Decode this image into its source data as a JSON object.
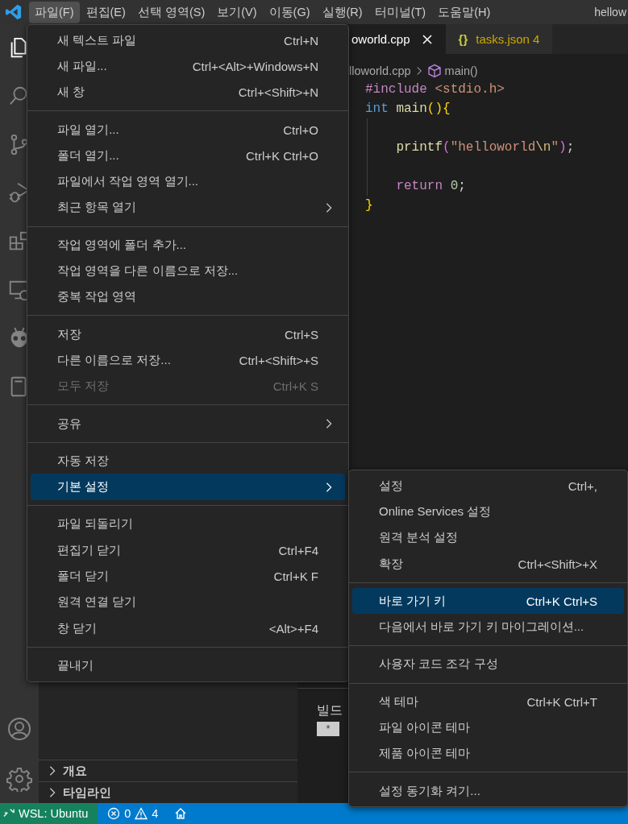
{
  "menubar": [
    {
      "label": "파일(F)",
      "selected": true
    },
    {
      "label": "편집(E)",
      "selected": false
    },
    {
      "label": "선택 영역(S)",
      "selected": false
    },
    {
      "label": "보기(V)",
      "selected": false
    },
    {
      "label": "이동(G)",
      "selected": false
    },
    {
      "label": "실행(R)",
      "selected": false
    },
    {
      "label": "터미널(T)",
      "selected": false
    },
    {
      "label": "도움말(H)",
      "selected": false
    }
  ],
  "window_title": "hellow",
  "activity_bar": [
    {
      "kind": "explorer",
      "selected": true
    },
    {
      "kind": "search",
      "selected": false
    },
    {
      "kind": "source-control",
      "selected": false
    },
    {
      "kind": "run-debug",
      "selected": false
    },
    {
      "kind": "extensions",
      "selected": false
    },
    {
      "kind": "remote",
      "selected": false
    },
    {
      "kind": "alien",
      "selected": false
    },
    {
      "kind": "notebook",
      "selected": false
    }
  ],
  "activity_bar_bottom": [
    {
      "kind": "account"
    },
    {
      "kind": "settings"
    }
  ],
  "sidebar_sections": [
    {
      "label": "개요",
      "expanded": false
    },
    {
      "label": "타임라인",
      "expanded": false
    }
  ],
  "tabs": [
    {
      "label": "oworld.cpp",
      "selected": true,
      "kind": "cpp"
    },
    {
      "label": "tasks.json 4",
      "icon": "{}",
      "selected": false,
      "kind": "json"
    }
  ],
  "breadcrumb": [
    {
      "label": "lloworld.cpp",
      "kind": "file"
    },
    {
      "label": "main()",
      "kind": "symbol"
    }
  ],
  "code_lines": [
    {
      "kind": "code",
      "tokens": [
        {
          "kind": "directive",
          "text": "#include "
        },
        {
          "kind": "include",
          "text": "<stdio.h>"
        }
      ]
    },
    {
      "kind": "code",
      "tokens": [
        {
          "kind": "keyword",
          "text": "int "
        },
        {
          "kind": "function",
          "text": "main"
        },
        {
          "kind": "bracket1",
          "text": "(){"
        }
      ]
    },
    {
      "kind": "blank"
    },
    {
      "kind": "nested",
      "tokens": [
        {
          "kind": "function",
          "text": "printf"
        },
        {
          "kind": "bracket2",
          "text": "("
        },
        {
          "kind": "string",
          "text": "\"helloworld"
        },
        {
          "kind": "escape",
          "text": "\\n"
        },
        {
          "kind": "string",
          "text": "\""
        },
        {
          "kind": "bracket2",
          "text": ")"
        },
        {
          "kind": "plain",
          "text": ";"
        }
      ]
    },
    {
      "kind": "blank"
    },
    {
      "kind": "nested",
      "tokens": [
        {
          "kind": "control",
          "text": "return "
        },
        {
          "kind": "number",
          "text": "0"
        },
        {
          "kind": "plain",
          "text": ";"
        }
      ]
    },
    {
      "kind": "code",
      "tokens": [
        {
          "kind": "bracket1",
          "text": "}"
        }
      ]
    }
  ],
  "terminal": {
    "lines": [
      "빌드"
    ],
    "cursor": "*"
  },
  "file_menu": {
    "items": [
      {
        "kind": "item",
        "label": "새 텍스트 파일",
        "shortcut": "Ctrl+N",
        "submenu": false,
        "disabled": false,
        "selected": false
      },
      {
        "kind": "item",
        "label": "새 파일...",
        "shortcut": "Ctrl+<Alt>+Windows+N",
        "submenu": false,
        "disabled": false,
        "selected": false
      },
      {
        "kind": "item",
        "label": "새 창",
        "shortcut": "Ctrl+<Shift>+N",
        "submenu": false,
        "disabled": false,
        "selected": false
      },
      {
        "kind": "separator"
      },
      {
        "kind": "item",
        "label": "파일 열기...",
        "shortcut": "Ctrl+O",
        "submenu": false,
        "disabled": false,
        "selected": false
      },
      {
        "kind": "item",
        "label": "폴더 열기...",
        "shortcut": "Ctrl+K Ctrl+O",
        "submenu": false,
        "disabled": false,
        "selected": false
      },
      {
        "kind": "item",
        "label": "파일에서 작업 영역 열기...",
        "submenu": false,
        "disabled": false,
        "selected": false
      },
      {
        "kind": "item",
        "label": "최근 항목 열기",
        "submenu": true,
        "disabled": false,
        "selected": false
      },
      {
        "kind": "separator"
      },
      {
        "kind": "item",
        "label": "작업 영역에 폴더 추가...",
        "submenu": false,
        "disabled": false,
        "selected": false
      },
      {
        "kind": "item",
        "label": "작업 영역을 다른 이름으로 저장...",
        "submenu": false,
        "disabled": false,
        "selected": false
      },
      {
        "kind": "item",
        "label": "중복 작업 영역",
        "submenu": false,
        "disabled": false,
        "selected": false
      },
      {
        "kind": "separator"
      },
      {
        "kind": "item",
        "label": "저장",
        "shortcut": "Ctrl+S",
        "submenu": false,
        "disabled": false,
        "selected": false
      },
      {
        "kind": "item",
        "label": "다른 이름으로 저장...",
        "shortcut": "Ctrl+<Shift>+S",
        "submenu": false,
        "disabled": false,
        "selected": false
      },
      {
        "kind": "item",
        "label": "모두 저장",
        "shortcut": "Ctrl+K S",
        "submenu": false,
        "disabled": true,
        "selected": false
      },
      {
        "kind": "separator"
      },
      {
        "kind": "item",
        "label": "공유",
        "submenu": true,
        "disabled": false,
        "selected": false
      },
      {
        "kind": "separator"
      },
      {
        "kind": "item",
        "label": "자동 저장",
        "submenu": false,
        "disabled": false,
        "selected": false
      },
      {
        "kind": "item",
        "label": "기본 설정",
        "submenu": true,
        "disabled": false,
        "selected": true
      },
      {
        "kind": "separator"
      },
      {
        "kind": "item",
        "label": "파일 되돌리기",
        "submenu": false,
        "disabled": false,
        "selected": false
      },
      {
        "kind": "item",
        "label": "편집기 닫기",
        "shortcut": "Ctrl+F4",
        "submenu": false,
        "disabled": false,
        "selected": false
      },
      {
        "kind": "item",
        "label": "폴더 닫기",
        "shortcut": "Ctrl+K F",
        "submenu": false,
        "disabled": false,
        "selected": false
      },
      {
        "kind": "item",
        "label": "원격 연결 닫기",
        "submenu": false,
        "disabled": false,
        "selected": false
      },
      {
        "kind": "item",
        "label": "창 닫기",
        "shortcut": "<Alt>+F4",
        "submenu": false,
        "disabled": false,
        "selected": false
      },
      {
        "kind": "separator"
      },
      {
        "kind": "item",
        "label": "끝내기",
        "submenu": false,
        "disabled": false,
        "selected": false
      }
    ]
  },
  "preferences_submenu": {
    "items": [
      {
        "kind": "item",
        "label": "설정",
        "shortcut": "Ctrl+,",
        "submenu": false,
        "disabled": false,
        "selected": false
      },
      {
        "kind": "item",
        "label": "Online Services 설정",
        "submenu": false,
        "disabled": false,
        "selected": false
      },
      {
        "kind": "item",
        "label": "원격 분석 설정",
        "submenu": false,
        "disabled": false,
        "selected": false
      },
      {
        "kind": "item",
        "label": "확장",
        "shortcut": "Ctrl+<Shift>+X",
        "submenu": false,
        "disabled": false,
        "selected": false
      },
      {
        "kind": "separator"
      },
      {
        "kind": "item",
        "label": "바로 가기 키",
        "shortcut": "Ctrl+K Ctrl+S",
        "submenu": false,
        "disabled": false,
        "selected": true
      },
      {
        "kind": "item",
        "label": "다음에서 바로 가기 키 마이그레이션...",
        "submenu": false,
        "disabled": false,
        "selected": false
      },
      {
        "kind": "separator"
      },
      {
        "kind": "item",
        "label": "사용자 코드 조각 구성",
        "submenu": false,
        "disabled": false,
        "selected": false
      },
      {
        "kind": "separator"
      },
      {
        "kind": "item",
        "label": "색 테마",
        "shortcut": "Ctrl+K Ctrl+T",
        "submenu": false,
        "disabled": false,
        "selected": false
      },
      {
        "kind": "item",
        "label": "파일 아이콘 테마",
        "submenu": false,
        "disabled": false,
        "selected": false
      },
      {
        "kind": "item",
        "label": "제품 아이콘 테마",
        "submenu": false,
        "disabled": false,
        "selected": false
      },
      {
        "kind": "separator"
      },
      {
        "kind": "item",
        "label": "설정 동기화 켜기...",
        "submenu": false,
        "disabled": false,
        "selected": false
      }
    ]
  },
  "status_bar": {
    "remote": "WSL: Ubuntu",
    "errors": "0",
    "warnings": "4"
  }
}
